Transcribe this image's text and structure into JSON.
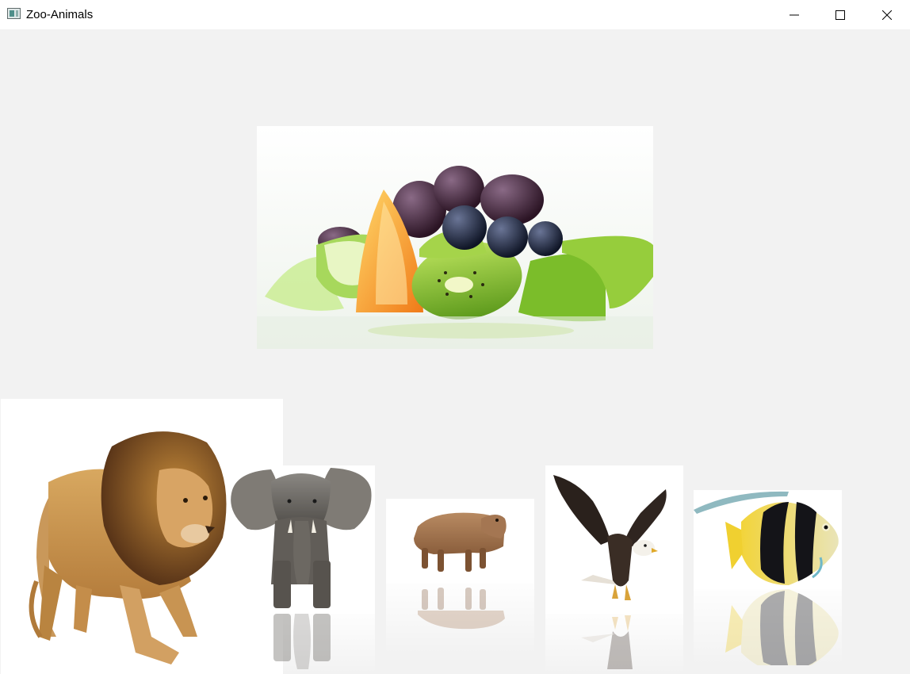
{
  "window": {
    "title": "Zoo-Animals",
    "controls": {
      "minimize": "minimize-icon",
      "maximize": "maximize-icon",
      "close": "close-icon"
    }
  },
  "featured": {
    "subject": "fruit-salad-image"
  },
  "gallery": [
    {
      "subject": "lion-image"
    },
    {
      "subject": "elephant-image"
    },
    {
      "subject": "capybara-image"
    },
    {
      "subject": "eagle-image"
    },
    {
      "subject": "fish-image"
    }
  ]
}
